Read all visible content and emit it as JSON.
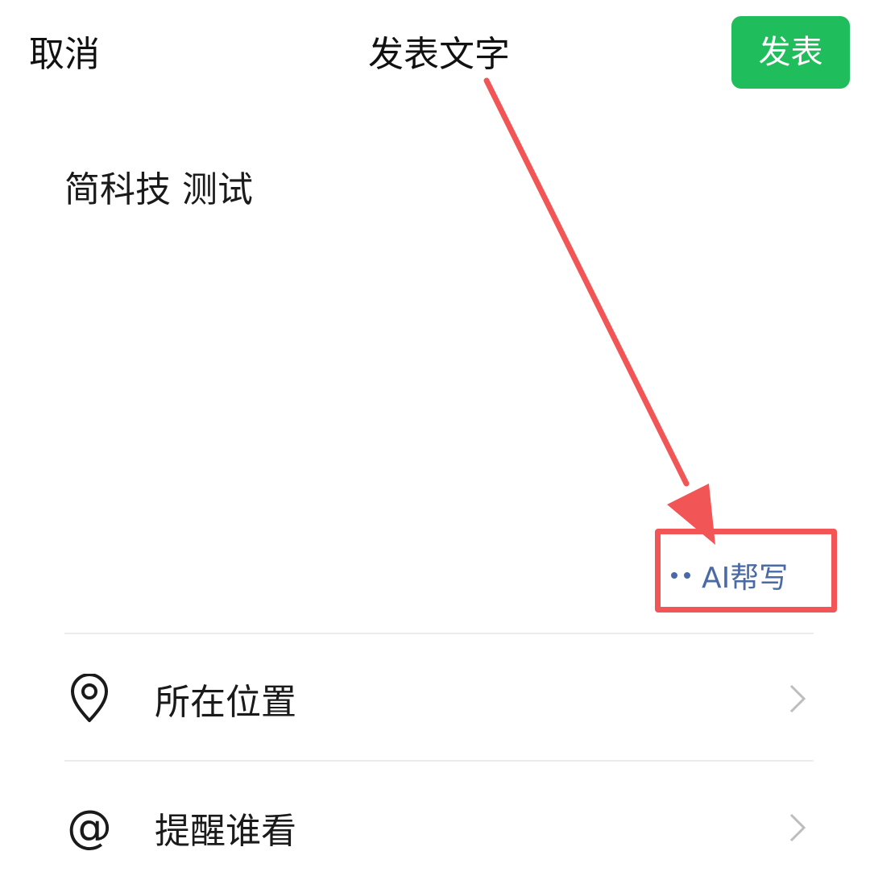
{
  "header": {
    "cancel_label": "取消",
    "title": "发表文字",
    "publish_label": "发表"
  },
  "editor": {
    "text": "简科技 测试"
  },
  "ai_write": {
    "label": "AI帮写"
  },
  "options": [
    {
      "label": "所在位置",
      "icon": "location-pin-icon"
    },
    {
      "label": "提醒谁看",
      "icon": "at-sign-icon"
    }
  ],
  "colors": {
    "publish_button": "#1fbd5c",
    "ai_write_text": "#4a6aa5",
    "annotation_red": "#f25555",
    "divider": "#ececec"
  }
}
